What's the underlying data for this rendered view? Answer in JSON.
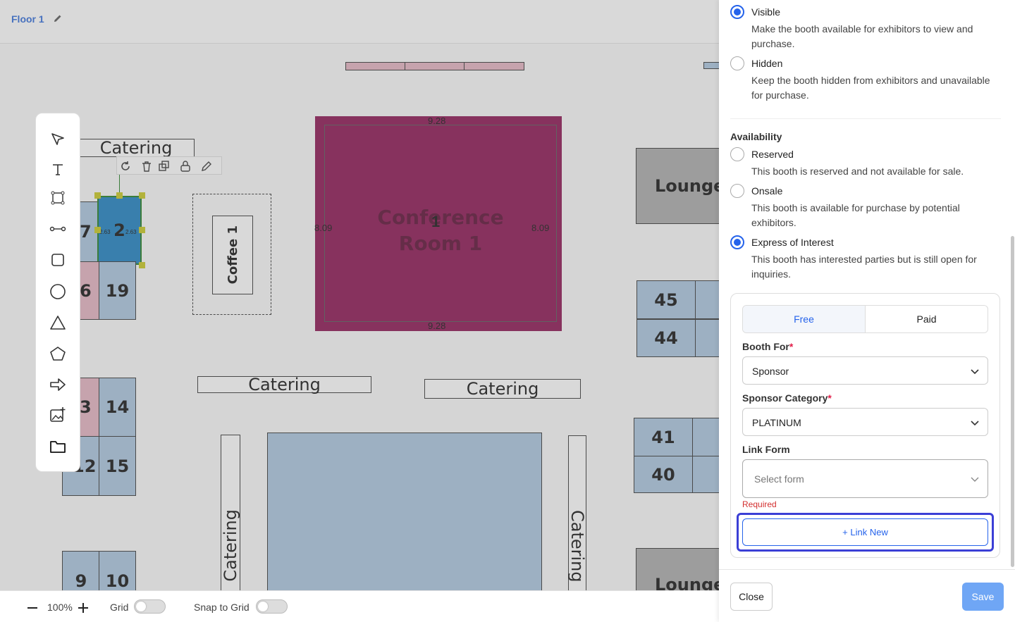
{
  "header": {
    "floor_title": "Floor 1"
  },
  "canvas": {
    "booths": {
      "b2": "2",
      "b7": "7",
      "b6": "6",
      "b19": "19",
      "b3": "3",
      "b14": "14",
      "b12": "12",
      "b15": "15",
      "b9": "9",
      "b10": "10",
      "b45": "45",
      "b44": "44",
      "b41": "41",
      "b40": "40"
    },
    "labels": {
      "catering": "Catering",
      "lounge": "Lounge",
      "coffee": "Coffee 1",
      "conference": "Conference Room 1",
      "conference_number": "1"
    },
    "measurements": {
      "top": "9.28",
      "bottom": "9.28",
      "left": "8.09",
      "right": "8.09",
      "small_left": "2.63",
      "small_right": "2.63"
    }
  },
  "bottom_bar": {
    "zoom": "100%",
    "grid_label": "Grid",
    "snap_label": "Snap to Grid"
  },
  "panel": {
    "visibility": [
      {
        "label": "Visible",
        "desc": "Make the booth available for exhibitors to view and purchase.",
        "checked": true
      },
      {
        "label": "Hidden",
        "desc": "Keep the booth hidden from exhibitors and unavailable for purchase.",
        "checked": false
      }
    ],
    "availability_label": "Availability",
    "availability": [
      {
        "label": "Reserved",
        "desc": "This booth is reserved and not available for sale.",
        "checked": false
      },
      {
        "label": "Onsale",
        "desc": "This booth is available for purchase by potential exhibitors.",
        "checked": false
      },
      {
        "label": "Express of Interest",
        "desc": "This booth has interested parties but is still open for inquiries.",
        "checked": true
      }
    ],
    "pricing_tabs": {
      "free": "Free",
      "paid": "Paid"
    },
    "booth_for": {
      "label": "Booth For",
      "required_mark": "*",
      "value": "Sponsor"
    },
    "sponsor_category": {
      "label": "Sponsor Category",
      "required_mark": "*",
      "value": "PLATINUM"
    },
    "link_form": {
      "label": "Link Form",
      "placeholder": "Select form",
      "error": "Required"
    },
    "link_new_label": "+ Link New",
    "close_label": "Close",
    "save_label": "Save"
  },
  "colors": {
    "accent": "#2563eb",
    "booth_blue": "#a9c4de",
    "booth_pink": "#e4b2c0",
    "conference": "#8a1150",
    "selected": "#1a7fc0"
  }
}
